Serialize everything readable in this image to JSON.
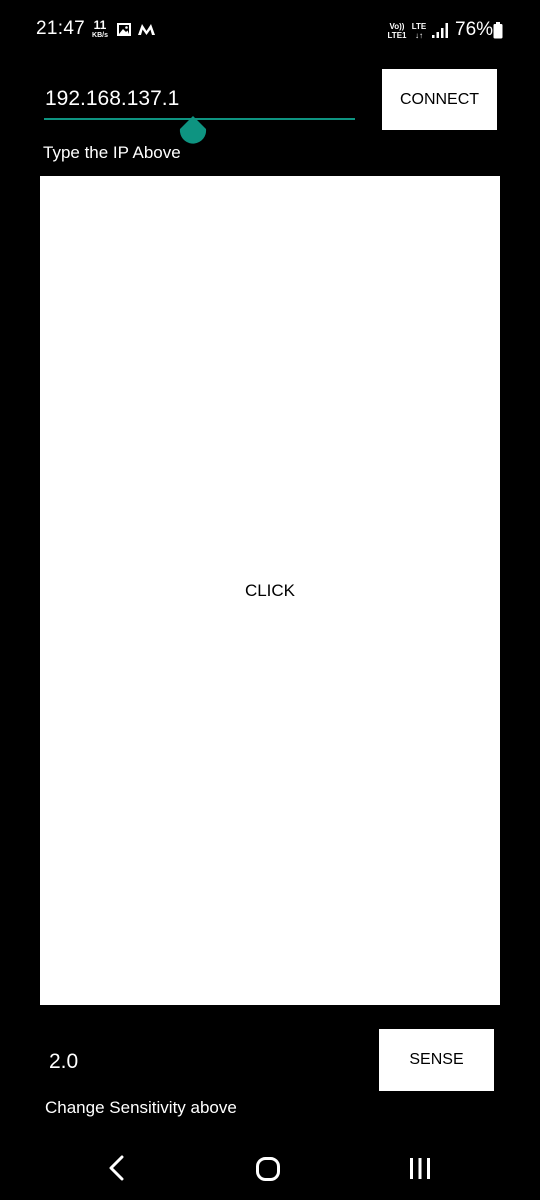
{
  "status_bar": {
    "time": "21:47",
    "net_speed_value": "11",
    "net_speed_unit": "KB/s",
    "notification_icons": [
      "gallery-icon",
      "m-icon"
    ],
    "volte_line1": "Vo))",
    "volte_line2": "LTE1",
    "lte_line1": "LTE",
    "lte_line2": "↓↑",
    "signal_icon": "signal-bars-icon",
    "battery_percent": "76%",
    "battery_level": 0.76
  },
  "ip_section": {
    "ip_value": "192.168.137.1",
    "connect_label": "CONNECT",
    "helper_text": "Type the IP Above",
    "accent_color": "#0e9481"
  },
  "touchpad": {
    "label": "CLICK"
  },
  "sensitivity_section": {
    "value": "2.0",
    "sense_label": "SENSE",
    "helper_text": "Change Sensitivity above"
  },
  "nav_bar": {
    "items": [
      "back-icon",
      "home-icon",
      "recents-icon"
    ]
  }
}
